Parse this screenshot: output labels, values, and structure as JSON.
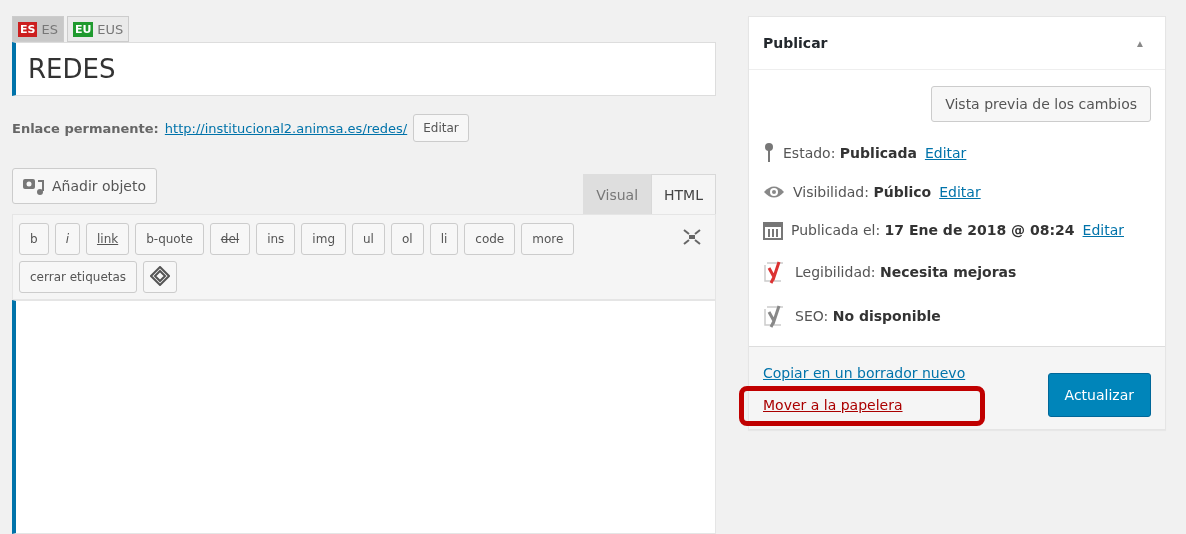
{
  "languages": [
    {
      "flag": "ES",
      "label": "ES",
      "color": "#cc1f1f",
      "selected": true
    },
    {
      "flag": "EU",
      "label": "EUS",
      "color": "#1f9a2e",
      "selected": false
    }
  ],
  "title": {
    "value": "REDES"
  },
  "permalink": {
    "label": "Enlace permanente:",
    "url": "http://institucional2.animsa.es/redes/",
    "button": "Editar"
  },
  "media_button": "Añadir objeto",
  "editor_tabs": [
    {
      "label": "Visual",
      "selected": false
    },
    {
      "label": "HTML",
      "selected": true
    }
  ],
  "quicktags": [
    {
      "label": "b",
      "kind": "plain"
    },
    {
      "label": "i",
      "kind": "italic"
    },
    {
      "label": "link",
      "kind": "underline"
    },
    {
      "label": "b-quote",
      "kind": "plain"
    },
    {
      "label": "del",
      "kind": "strike"
    },
    {
      "label": "ins",
      "kind": "plain"
    },
    {
      "label": "img",
      "kind": "plain"
    },
    {
      "label": "ul",
      "kind": "plain"
    },
    {
      "label": "ol",
      "kind": "plain"
    },
    {
      "label": "li",
      "kind": "plain"
    },
    {
      "label": "code",
      "kind": "plain"
    },
    {
      "label": "more",
      "kind": "plain"
    },
    {
      "label": "cerrar etiquetas",
      "kind": "plain"
    },
    {
      "kind": "icon"
    }
  ],
  "publish": {
    "title": "Publicar",
    "toggle": "▲",
    "preview_button": "Vista previa de los cambios",
    "rows": [
      {
        "kind": "pin",
        "label": "Estado:",
        "value": "Publicada",
        "link": "Editar"
      },
      {
        "kind": "eye",
        "label": "Visibilidad:",
        "value": "Público",
        "link": "Editar"
      },
      {
        "kind": "calendar",
        "label": "Publicada el:",
        "value": "17 Ene de 2018 @ 08:24",
        "link": "Editar"
      },
      {
        "kind": "yoast",
        "color": "#dc3232",
        "label": "Legibilidad:",
        "value": "Necesita mejoras"
      },
      {
        "kind": "yoast",
        "color": "#888888",
        "label": "SEO:",
        "value": "No disponible"
      }
    ],
    "copy_link": "Copiar en un borrador nuevo",
    "trash_link": "Mover a la papelera",
    "trash_highlighted": true,
    "update_button": "Actualizar"
  }
}
